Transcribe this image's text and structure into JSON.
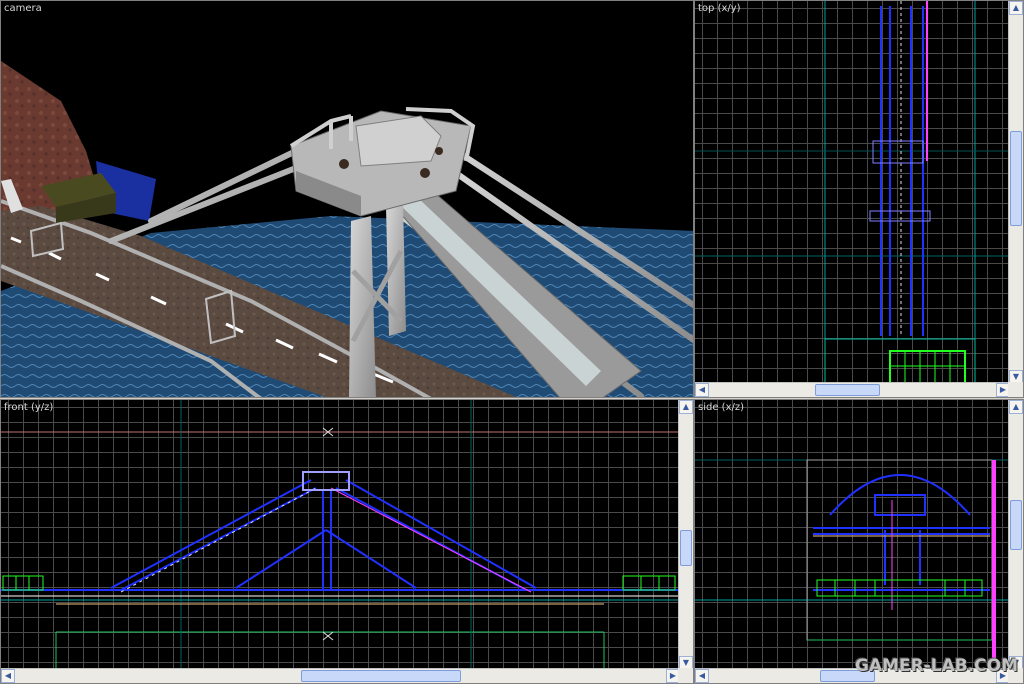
{
  "viewports": {
    "camera": {
      "label": "camera"
    },
    "top": {
      "label": "top (x/y)"
    },
    "front": {
      "label": "front (y/z)"
    },
    "side": {
      "label": "side (x/z)"
    }
  },
  "watermark": {
    "text": "GAMER-LAB.COM"
  },
  "colors": {
    "grid": "#5a5a5a",
    "brush_blue": "#2030ff",
    "brush_white": "#ffffff",
    "selection_magenta": "#ff40ff",
    "entity_green": "#20ff20",
    "axis_teal": "#00a0a0",
    "scroll_bg": "#eceae4",
    "scroll_thumb": "#c8d8f8"
  },
  "icons": {
    "up_arrow": "up-arrow-icon",
    "down_arrow": "down-arrow-icon",
    "left_arrow": "left-arrow-icon",
    "right_arrow": "right-arrow-icon"
  }
}
